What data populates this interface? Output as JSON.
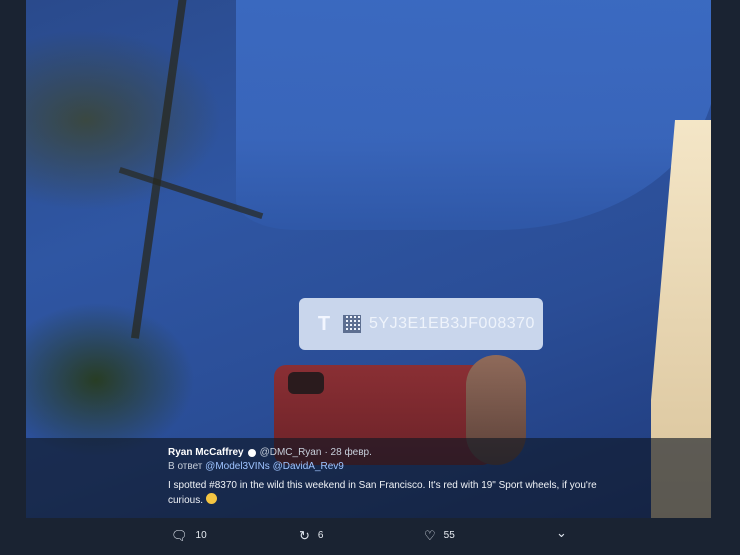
{
  "photo": {
    "vin": "5YJ3E1EB3JF008370",
    "logo_icon": "tesla-logo-icon",
    "logo_glyph": "T"
  },
  "tweet": {
    "author_name": "Ryan McCaffrey",
    "handle": "@DMC_Ryan",
    "date": "· 28 февр.",
    "reply_prefix": "В ответ",
    "reply_mentions": "@Model3VINs @DavidA_Rev9",
    "text": "I spotted #8370 in the wild this weekend in San Francisco. It's red with 19\" Sport wheels, if you're curious."
  },
  "actions": {
    "reply_count": "10",
    "retweet_count": "6",
    "like_count": "55",
    "reply_icon": "reply-icon",
    "retweet_icon": "retweet-icon",
    "like_icon": "heart-icon",
    "more_icon": "chevron-down-icon"
  }
}
